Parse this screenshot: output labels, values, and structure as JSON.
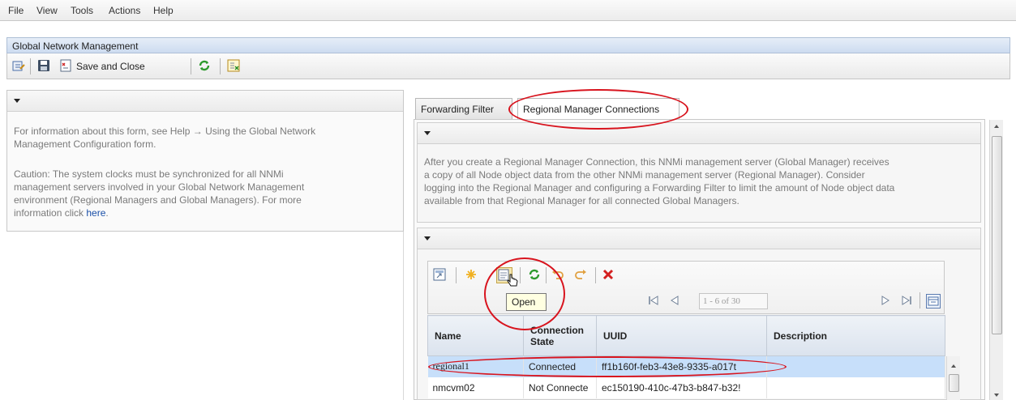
{
  "menu": [
    "File",
    "View",
    "Tools",
    "Actions",
    "Help"
  ],
  "window_title": "Global Network Management",
  "toolbar": {
    "save_close_label": "Save and Close"
  },
  "left_panel": {
    "info_line1": "For information about this form, see Help → Using the Global Network",
    "info_line2": "Management Configuration form.",
    "caution_line1": "Caution: The system clocks must be synchronized for all NNMi",
    "caution_line2": "management servers involved in your Global Network Management",
    "caution_line3": "environment (Regional Managers and Global Managers). For more",
    "caution_line4_prefix": "information click ",
    "caution_link": "here",
    "caution_line4_suffix": "."
  },
  "tabs": [
    {
      "label": "Forwarding Filter",
      "active": false
    },
    {
      "label": "Regional Manager Connections",
      "active": true
    }
  ],
  "description": {
    "line1": "After you create a Regional Manager Connection, this NNMi management server (Global Manager) receives",
    "line2": "a copy of all Node object data from the other NNMi management server (Regional Manager). Consider",
    "line3": "logging into the Regional Manager and configuring a Forwarding Filter to limit the amount of Node object data",
    "line4": "available from that Regional Manager for all connected Global Managers."
  },
  "grid": {
    "tooltip": "Open",
    "pager_text": "1 - 6 of 30",
    "columns": [
      "Name",
      "Connection State",
      "UUID",
      "Description"
    ],
    "rows": [
      {
        "name": "regional1",
        "state": "Connected",
        "uuid": "ff1b160f-feb3-43e8-9335-a017t",
        "description": "",
        "selected": true
      },
      {
        "name": "nmcvm02",
        "state": "Not Connecte",
        "uuid": "ec150190-410c-47b3-b847-b32!",
        "description": "",
        "selected": false
      }
    ]
  },
  "colors": {
    "highlight": "#d8141e",
    "selected_row": "#c7dffa",
    "link": "#1a4fa8"
  },
  "icons": [
    "edit-icon",
    "save-icon",
    "save-close-icon",
    "refresh-icon",
    "export-icon",
    "open-in-new-icon",
    "new-icon",
    "open-icon",
    "undo-icon",
    "redo-icon",
    "delete-icon",
    "first-page-icon",
    "prev-page-icon",
    "next-page-icon",
    "last-page-icon",
    "table-options-icon"
  ]
}
